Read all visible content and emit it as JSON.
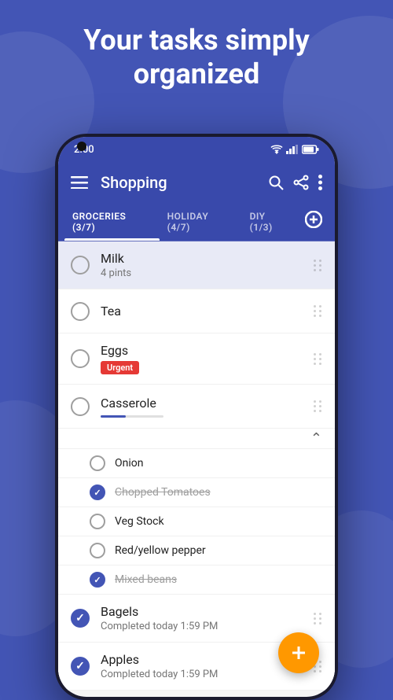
{
  "hero": {
    "title": "Your tasks simply organized",
    "bg_color": "#4355b5"
  },
  "status_bar": {
    "time": "2:00",
    "accent_color": "#3949ab"
  },
  "app_bar": {
    "title": "Shopping",
    "menu_icon": "menu-icon",
    "search_icon": "search-icon",
    "share_icon": "share-icon",
    "more_icon": "more-icon"
  },
  "tabs": [
    {
      "label": "GROCERIES (3/7)",
      "active": true
    },
    {
      "label": "HOLIDAY (4/7)",
      "active": false
    },
    {
      "label": "DIY (1/3)",
      "active": false
    }
  ],
  "tasks": [
    {
      "id": 1,
      "name": "Milk",
      "subtitle": "4 pints",
      "checked": false,
      "highlighted": true,
      "tag": null
    },
    {
      "id": 2,
      "name": "Tea",
      "subtitle": null,
      "checked": false,
      "highlighted": false,
      "tag": null
    },
    {
      "id": 3,
      "name": "Eggs",
      "subtitle": null,
      "checked": false,
      "highlighted": false,
      "tag": "Urgent"
    },
    {
      "id": 4,
      "name": "Casserole",
      "subtitle": null,
      "checked": false,
      "highlighted": false,
      "tag": null,
      "has_subtasks": true
    }
  ],
  "subtasks": [
    {
      "name": "Onion",
      "checked": false,
      "strikethrough": false
    },
    {
      "name": "Chopped Tomatoes",
      "checked": true,
      "strikethrough": true
    },
    {
      "name": "Veg Stock",
      "checked": false,
      "strikethrough": false
    },
    {
      "name": "Red/yellow pepper",
      "checked": false,
      "strikethrough": false
    },
    {
      "name": "Mixed beans",
      "checked": true,
      "strikethrough": true
    }
  ],
  "completed_tasks": [
    {
      "name": "Bagels",
      "subtitle": "Completed today 1:59 PM",
      "checked": true
    },
    {
      "name": "Apples",
      "subtitle": "Completed today 1:59 PM",
      "checked": true
    }
  ],
  "fab": {
    "icon": "add-icon",
    "color": "#ff9800"
  }
}
